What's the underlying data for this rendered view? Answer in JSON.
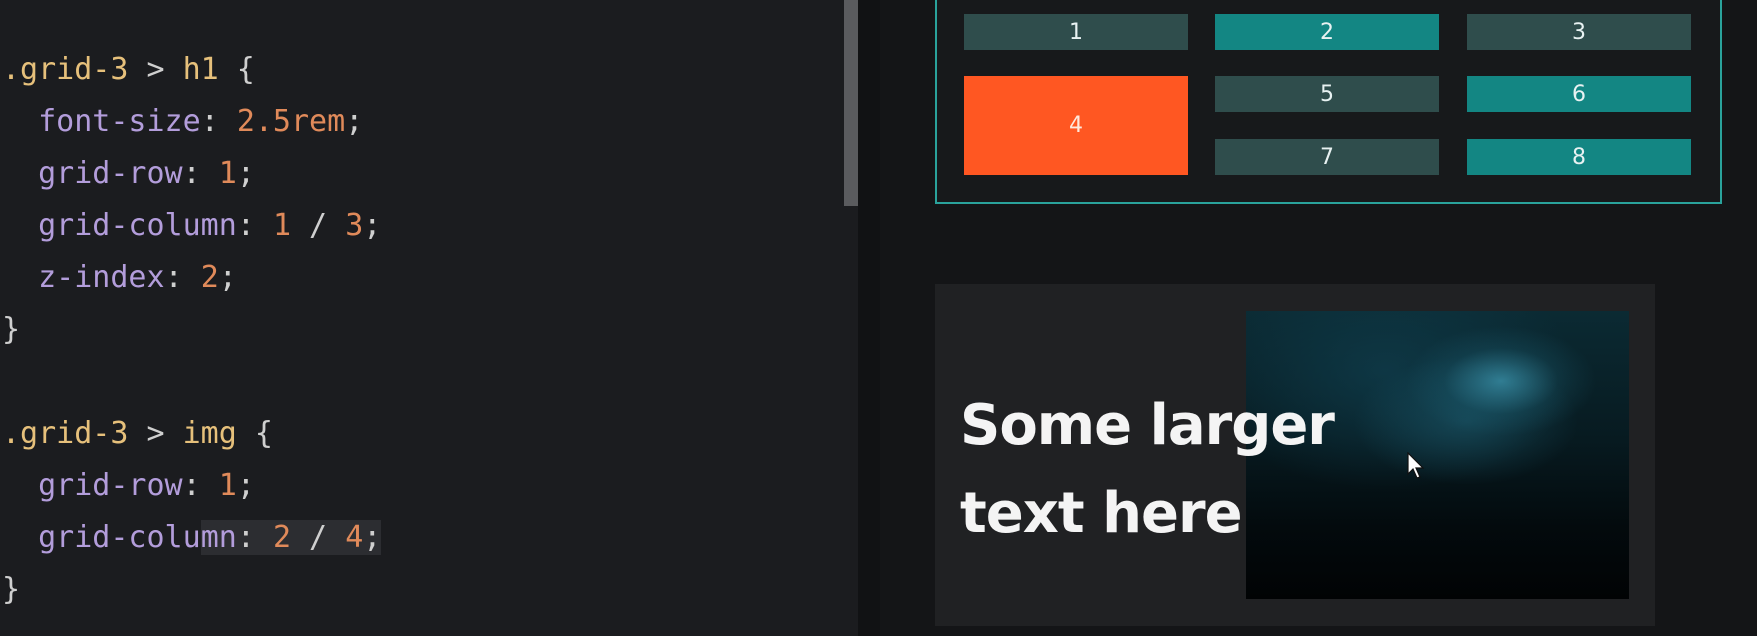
{
  "editor": {
    "lines": [
      [
        {
          "t": ".grid-3",
          "c": "sel"
        },
        {
          "t": " > ",
          "c": "op"
        },
        {
          "t": "h1",
          "c": "tag"
        },
        {
          "t": " {",
          "c": "pun"
        }
      ],
      [
        {
          "t": "  font-size",
          "c": "prop"
        },
        {
          "t": ": ",
          "c": "pun"
        },
        {
          "t": "2.5rem",
          "c": "num"
        },
        {
          "t": ";",
          "c": "pun"
        }
      ],
      [
        {
          "t": "  grid-row",
          "c": "prop"
        },
        {
          "t": ": ",
          "c": "pun"
        },
        {
          "t": "1",
          "c": "num"
        },
        {
          "t": ";",
          "c": "pun"
        }
      ],
      [
        {
          "t": "  grid-column",
          "c": "prop"
        },
        {
          "t": ": ",
          "c": "pun"
        },
        {
          "t": "1",
          "c": "num"
        },
        {
          "t": " / ",
          "c": "pun"
        },
        {
          "t": "3",
          "c": "num"
        },
        {
          "t": ";",
          "c": "pun"
        }
      ],
      [
        {
          "t": "  z-index",
          "c": "prop"
        },
        {
          "t": ": ",
          "c": "pun"
        },
        {
          "t": "2",
          "c": "num"
        },
        {
          "t": ";",
          "c": "pun"
        }
      ],
      [
        {
          "t": "}",
          "c": "pun"
        }
      ],
      [],
      [
        {
          "t": ".grid-3",
          "c": "sel"
        },
        {
          "t": " > ",
          "c": "op"
        },
        {
          "t": "img",
          "c": "tag"
        },
        {
          "t": " {",
          "c": "pun"
        }
      ],
      [
        {
          "t": "  grid-row",
          "c": "prop"
        },
        {
          "t": ": ",
          "c": "pun"
        },
        {
          "t": "1",
          "c": "num"
        },
        {
          "t": ";",
          "c": "pun"
        }
      ],
      [
        {
          "t": "  grid-colu",
          "c": "prop"
        },
        {
          "t": "mn",
          "c": "prop hl"
        },
        {
          "t": ": ",
          "c": "pun hl"
        },
        {
          "t": "2",
          "c": "num hl"
        },
        {
          "t": " / ",
          "c": "pun hl"
        },
        {
          "t": "4",
          "c": "num hl"
        },
        {
          "t": ";",
          "c": "pun hl"
        }
      ],
      [
        {
          "t": "}",
          "c": "pun"
        }
      ]
    ]
  },
  "preview": {
    "grid_cells": [
      {
        "label": "1",
        "color": "gray"
      },
      {
        "label": "2",
        "color": "teal"
      },
      {
        "label": "3",
        "color": "gray"
      },
      {
        "label": "4",
        "color": "orange"
      },
      {
        "label": "5",
        "color": "gray"
      },
      {
        "label": "6",
        "color": "teal"
      },
      {
        "label": "7",
        "color": "gray"
      },
      {
        "label": "8",
        "color": "teal"
      }
    ],
    "card": {
      "heading_line1": "Some larger",
      "heading_line2": "text here",
      "image_icon": "nebula-image"
    }
  },
  "colors": {
    "accent_teal": "#138683",
    "cell_gray": "#2f4d4c",
    "highlight_orange": "#ff5722",
    "frame_border": "#2aa39c"
  }
}
